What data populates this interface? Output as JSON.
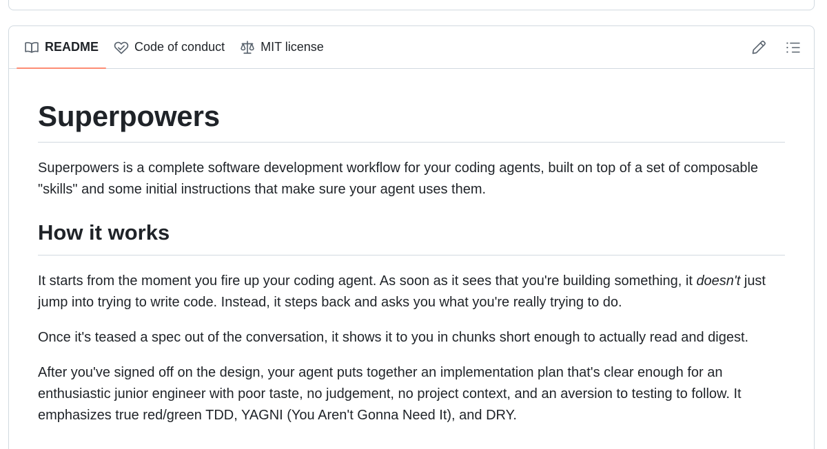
{
  "tabs": [
    {
      "label": "README",
      "icon": "book-icon",
      "active": true
    },
    {
      "label": "Code of conduct",
      "icon": "code-of-conduct-icon",
      "active": false
    },
    {
      "label": "MIT license",
      "icon": "law-scale-icon",
      "active": false
    }
  ],
  "actions": {
    "edit_icon": "pencil-icon",
    "outline_icon": "list-outline-icon"
  },
  "readme": {
    "title": "Superpowers",
    "intro": "Superpowers is a complete software development workflow for your coding agents, built on top of a set of composable \"skills\" and some initial instructions that make sure your agent uses them.",
    "section_heading": "How it works",
    "p1_start": "It starts from the moment you fire up your coding agent. As soon as it sees that you're building something, it ",
    "p1_em": "doesn't",
    "p1_end": " just jump into trying to write code. Instead, it steps back and asks you what you're really trying to do.",
    "p2": "Once it's teased a spec out of the conversation, it shows it to you in chunks short enough to actually read and digest.",
    "p3": "After you've signed off on the design, your agent puts together an implementation plan that's clear enough for an enthusiastic junior engineer with poor taste, no judgement, no project context, and an aversion to testing to follow. It emphasizes true red/green TDD, YAGNI (You Aren't Gonna Need It), and DRY."
  },
  "colors": {
    "active_tab_underline": "#fd8c73",
    "border": "#d1d9e0",
    "text": "#1f2328"
  }
}
